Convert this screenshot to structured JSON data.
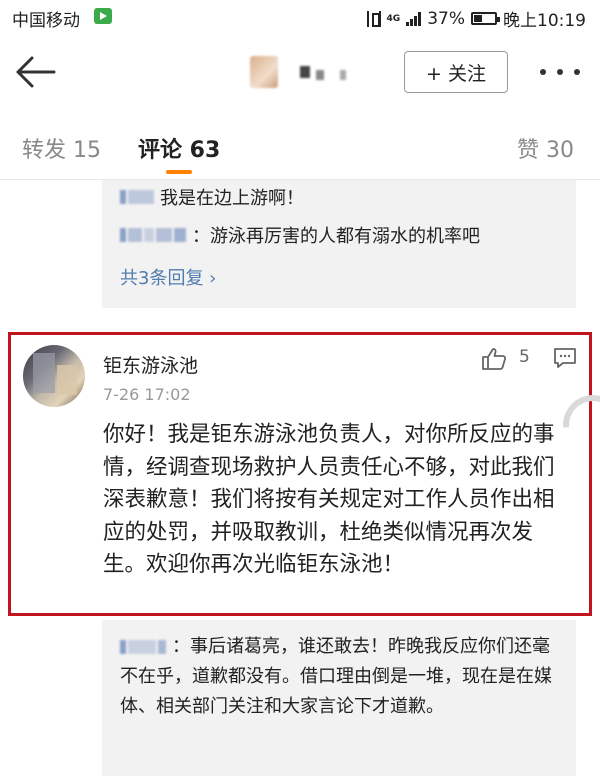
{
  "status_bar": {
    "carrier": "中国移动",
    "network": "4G",
    "battery": "37%",
    "time": "晚上10:19"
  },
  "nav": {
    "follow_label": "+ 关注"
  },
  "tabs": {
    "repost": "转发 15",
    "comment": "评论 63",
    "like": "赞 30"
  },
  "top_replies": [
    {
      "text": "我是在边上游啊！"
    },
    {
      "text": "：游泳再厉害的人都有溺水的机率吧"
    }
  ],
  "top_replies_more": "共3条回复 ›",
  "comment": {
    "author": "钜东游泳池",
    "time": "7-26 17:02",
    "like_count": "5",
    "body": "你好！我是钜东游泳池负责人，对你所反应的事情，经调查现场救护人员责任心不够，对此我们深表歉意！我们将按有关规定对工作人员作出相应的处罚，并吸取教训，杜绝类似情况再次发生。欢迎你再次光临钜东泳池！"
  },
  "bottom_reply": {
    "text": "：事后诸葛亮，谁还敢去！昨晚我反应你们还毫不在乎，道歉都没有。借口理由倒是一堆，现在是在媒体、相关部门关注和大家言论下才道歉。"
  },
  "colors": {
    "accent": "#ff8200",
    "link": "#507daf",
    "highlight_border": "#c0141f"
  }
}
